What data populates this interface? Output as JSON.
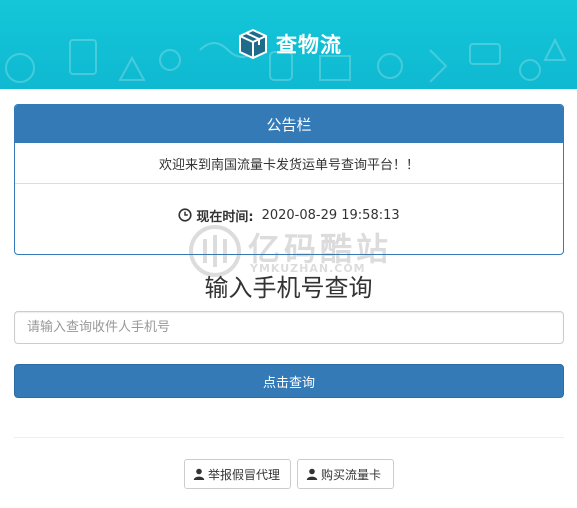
{
  "header": {
    "brand_name": "查物流",
    "logo_icon": "package-box-icon",
    "background_color": "#13c2d6"
  },
  "notice": {
    "title": "公告栏",
    "message": "欢迎来到南国流量卡发货运单号查询平台！！",
    "time_label": "现在时间:",
    "time_value": "2020-08-29 19:58:13",
    "clock_icon": "clock-icon",
    "accent_color": "#337ab7"
  },
  "watermark": {
    "text": "亿码酷站",
    "subtext": "YMKUZHAN.COM"
  },
  "main": {
    "title": "输入手机号查询",
    "search_placeholder": "请输入查询收件人手机号",
    "search_value": "",
    "query_button": "点击查询"
  },
  "footer": {
    "report_button": "举报假冒代理",
    "buy_button": "购买流量卡",
    "user_icon": "user-icon"
  }
}
